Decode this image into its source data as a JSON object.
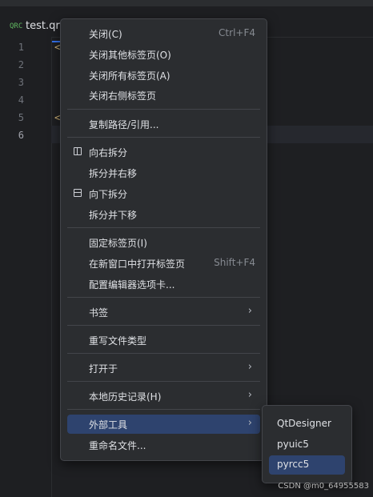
{
  "editor_tab": {
    "icon_text": "QRC",
    "title": "test.qrc"
  },
  "gutter": {
    "lines": [
      "1",
      "2",
      "3",
      "4",
      "5",
      "6"
    ],
    "current_line": "6"
  },
  "code": {
    "line1_fragment": "<",
    "line5_fragment": "<"
  },
  "context_menu": {
    "close": {
      "label": "关闭(C)",
      "shortcut": "Ctrl+F4"
    },
    "close_others": {
      "label": "关闭其他标签页(O)"
    },
    "close_all": {
      "label": "关闭所有标签页(A)"
    },
    "close_right": {
      "label": "关闭右侧标签页"
    },
    "copy_path": {
      "label": "复制路径/引用..."
    },
    "split_right": {
      "label": "向右拆分",
      "icon": "split-vertical-icon"
    },
    "split_move_right": {
      "label": "拆分并右移"
    },
    "split_down": {
      "label": "向下拆分",
      "icon": "split-horizontal-icon"
    },
    "split_move_down": {
      "label": "拆分并下移"
    },
    "pin_tab": {
      "label": "固定标签页(I)"
    },
    "open_new_window": {
      "label": "在新窗口中打开标签页",
      "shortcut": "Shift+F4"
    },
    "configure_tabs": {
      "label": "配置编辑器选项卡..."
    },
    "bookmarks": {
      "label": "书签"
    },
    "override_file_type": {
      "label": "重写文件类型"
    },
    "open_in": {
      "label": "打开于"
    },
    "local_history": {
      "label": "本地历史记录(H)"
    },
    "external_tools": {
      "label": "外部工具",
      "selected": true
    },
    "rename_file": {
      "label": "重命名文件..."
    },
    "submenu_arrow": "›"
  },
  "external_tools_submenu": {
    "items": [
      "QtDesigner",
      "pyuic5",
      "pyrcc5"
    ],
    "selected": "pyrcc5"
  },
  "watermark": "CSDN @m0_64955583",
  "colors": {
    "background": "#1e1f22",
    "menu_background": "#2b2d30",
    "selection": "#2e436e",
    "accent": "#3574f0"
  }
}
